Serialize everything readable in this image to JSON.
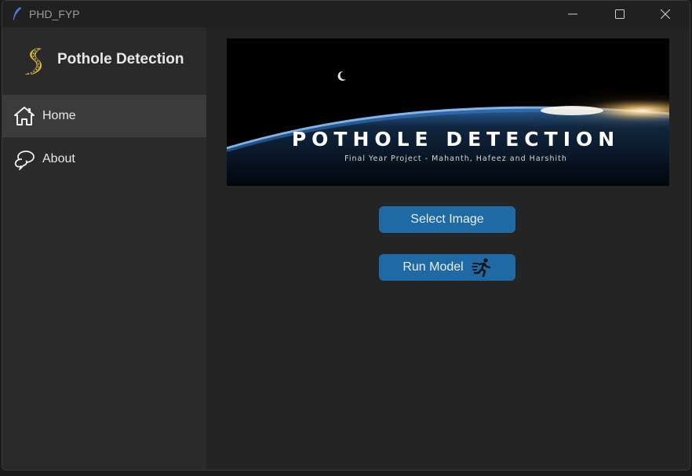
{
  "window": {
    "title": "PHD_FYP",
    "controls": {
      "minimize": "minimize-icon",
      "maximize": "maximize-icon",
      "close": "close-icon"
    }
  },
  "sidebar": {
    "brand": "Pothole Detection",
    "brand_icon": "road-icon",
    "items": [
      {
        "label": "Home",
        "icon": "home-icon",
        "active": true
      },
      {
        "label": "About",
        "icon": "chat-bubbles-icon",
        "active": false
      }
    ]
  },
  "main": {
    "banner": {
      "title": "POTHOLE DETECTION",
      "subtitle": "Final Year Project - Mahanth, Hafeez and Harshith"
    },
    "buttons": {
      "select_image": "Select Image",
      "run_model": "Run Model",
      "run_model_icon": "running-person-icon"
    }
  },
  "colors": {
    "accent": "#1f6aa5",
    "sidebar_bg": "#2a2a2a",
    "active_item_bg": "#3b3b3b",
    "content_bg": "#242424",
    "titlebar_bg": "#202020"
  }
}
